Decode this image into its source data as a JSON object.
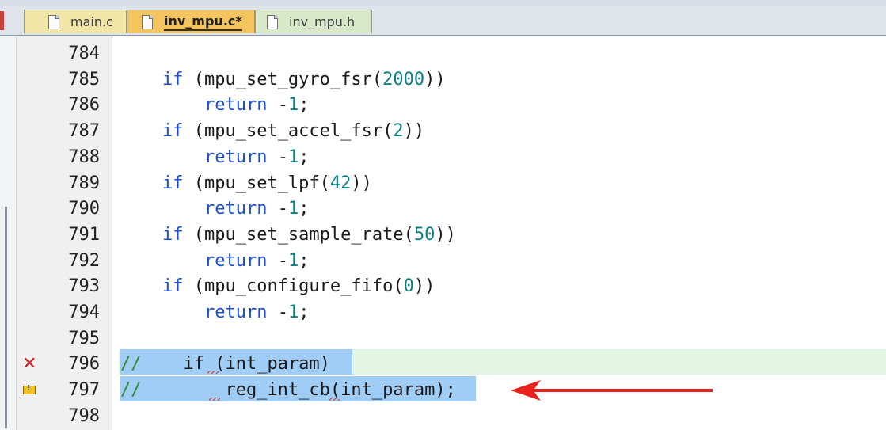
{
  "tabs": [
    {
      "label": "main.c",
      "active": false
    },
    {
      "label": "inv_mpu.c*",
      "active": true
    },
    {
      "label": "inv_mpu.h",
      "active": false
    }
  ],
  "lines": [
    {
      "num": "784",
      "parts": []
    },
    {
      "num": "785",
      "parts": [
        [
          "",
          "    "
        ],
        [
          "kw",
          "if"
        ],
        [
          "",
          " (mpu_set_gyro_fsr("
        ],
        [
          "num",
          "2000"
        ],
        [
          "",
          "))"
        ]
      ]
    },
    {
      "num": "786",
      "parts": [
        [
          "",
          "        "
        ],
        [
          "kw",
          "return"
        ],
        [
          "",
          " -"
        ],
        [
          "num",
          "1"
        ],
        [
          "",
          ";"
        ]
      ]
    },
    {
      "num": "787",
      "parts": [
        [
          "",
          "    "
        ],
        [
          "kw",
          "if"
        ],
        [
          "",
          " (mpu_set_accel_fsr("
        ],
        [
          "num",
          "2"
        ],
        [
          "",
          "))"
        ]
      ]
    },
    {
      "num": "788",
      "parts": [
        [
          "",
          "        "
        ],
        [
          "kw",
          "return"
        ],
        [
          "",
          " -"
        ],
        [
          "num",
          "1"
        ],
        [
          "",
          ";"
        ]
      ]
    },
    {
      "num": "789",
      "parts": [
        [
          "",
          "    "
        ],
        [
          "kw",
          "if"
        ],
        [
          "",
          " (mpu_set_lpf("
        ],
        [
          "num",
          "42"
        ],
        [
          "",
          "))"
        ]
      ]
    },
    {
      "num": "790",
      "parts": [
        [
          "",
          "        "
        ],
        [
          "kw",
          "return"
        ],
        [
          "",
          " -"
        ],
        [
          "num",
          "1"
        ],
        [
          "",
          ";"
        ]
      ]
    },
    {
      "num": "791",
      "parts": [
        [
          "",
          "    "
        ],
        [
          "kw",
          "if"
        ],
        [
          "",
          " (mpu_set_sample_rate("
        ],
        [
          "num",
          "50"
        ],
        [
          "",
          "))"
        ]
      ]
    },
    {
      "num": "792",
      "parts": [
        [
          "",
          "        "
        ],
        [
          "kw",
          "return"
        ],
        [
          "",
          " -"
        ],
        [
          "num",
          "1"
        ],
        [
          "",
          ";"
        ]
      ]
    },
    {
      "num": "793",
      "parts": [
        [
          "",
          "    "
        ],
        [
          "kw",
          "if"
        ],
        [
          "",
          " (mpu_configure_fifo("
        ],
        [
          "num",
          "0"
        ],
        [
          "",
          "))"
        ]
      ]
    },
    {
      "num": "794",
      "parts": [
        [
          "",
          "        "
        ],
        [
          "kw",
          "return"
        ],
        [
          "",
          " -"
        ],
        [
          "num",
          "1"
        ],
        [
          "",
          ";"
        ]
      ]
    },
    {
      "num": "795",
      "parts": []
    },
    {
      "num": "796",
      "parts": [
        [
          "cmt",
          "//"
        ],
        [
          "",
          "    if (int_param)"
        ]
      ],
      "marker": "error-icon"
    },
    {
      "num": "797",
      "parts": [
        [
          "cmt",
          "//"
        ],
        [
          "",
          "        reg_int_cb(int_param);"
        ]
      ],
      "marker": "warning-icon"
    },
    {
      "num": "798",
      "parts": []
    }
  ],
  "colors": {
    "keyword": "#1b4fd1",
    "number": "#0a7f86",
    "comment": "#2e8b2e",
    "selection": "#9fcdf6",
    "current_line": "#e3f6e3",
    "annotation_arrow": "#e8231c"
  },
  "icons": [
    "file-icon",
    "error-icon",
    "warning-icon",
    "red-arrow-icon"
  ]
}
